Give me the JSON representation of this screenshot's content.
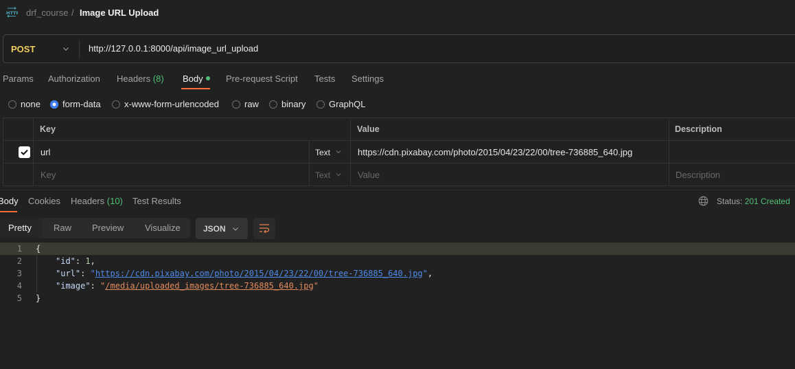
{
  "breadcrumb": {
    "icon": "http-icon",
    "collection": "drf_course",
    "separator": "/",
    "request_name": "Image URL Upload"
  },
  "request": {
    "method": "POST",
    "url": "http://127.0.0.1:8000/api/image_url_upload"
  },
  "request_tabs": [
    {
      "label": "Params"
    },
    {
      "label": "Authorization"
    },
    {
      "label": "Headers",
      "count": "(8)"
    },
    {
      "label": "Body",
      "active": true,
      "indicator": "green-dot"
    },
    {
      "label": "Pre-request Script"
    },
    {
      "label": "Tests"
    },
    {
      "label": "Settings"
    }
  ],
  "body_types": [
    {
      "label": "none",
      "selected": false
    },
    {
      "label": "form-data",
      "selected": true
    },
    {
      "label": "x-www-form-urlencoded",
      "selected": false
    },
    {
      "label": "raw",
      "selected": false
    },
    {
      "label": "binary",
      "selected": false
    },
    {
      "label": "GraphQL",
      "selected": false
    }
  ],
  "form_table": {
    "headers": {
      "key": "Key",
      "value": "Value",
      "description": "Description"
    },
    "rows": [
      {
        "checked": true,
        "key": "url",
        "type": "Text",
        "value": "https://cdn.pixabay.com/photo/2015/04/23/22/00/tree-736885_640.jpg",
        "description": ""
      }
    ],
    "new_row": {
      "key_placeholder": "Key",
      "type": "Text",
      "value_placeholder": "Value",
      "description_placeholder": "Description"
    }
  },
  "response_tabs": [
    {
      "label": "Body",
      "active": true
    },
    {
      "label": "Cookies"
    },
    {
      "label": "Headers",
      "count": "(10)"
    },
    {
      "label": "Test Results"
    }
  ],
  "status": {
    "label": "Status:",
    "value": "201 Created",
    "color": "#4fc174"
  },
  "view_modes": [
    {
      "label": "Pretty",
      "active": true
    },
    {
      "label": "Raw"
    },
    {
      "label": "Preview"
    },
    {
      "label": "Visualize"
    }
  ],
  "format": "JSON",
  "response_body": {
    "line_numbers": [
      "1",
      "2",
      "3",
      "4",
      "5"
    ],
    "open_brace": "{",
    "close_brace": "}",
    "fields": [
      {
        "key": "\"id\"",
        "value": "1"
      },
      {
        "key": "\"url\"",
        "value": "https://cdn.pixabay.com/photo/2015/04/23/22/00/tree-736885_640.jpg"
      },
      {
        "key": "\"image\"",
        "value": "/media/uploaded_images/tree-736885_640.jpg"
      }
    ]
  },
  "colors": {
    "accent": "#ff6c37",
    "method": "#f2cd5e",
    "success": "#4fc174",
    "link": "#4d8ae8"
  }
}
